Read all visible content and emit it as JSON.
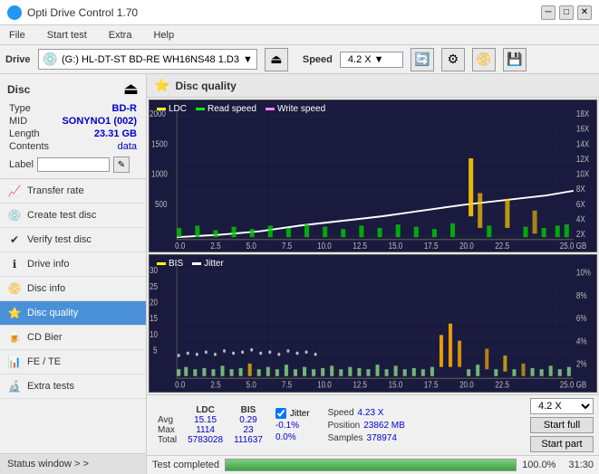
{
  "titlebar": {
    "title": "Opti Drive Control 1.70",
    "icon": "disc-icon",
    "controls": [
      "minimize",
      "maximize",
      "close"
    ]
  },
  "menubar": {
    "items": [
      "File",
      "Start test",
      "Extra",
      "Help"
    ]
  },
  "drivebar": {
    "label": "Drive",
    "drive_value": "(G:)  HL-DT-ST BD-RE  WH16NS48 1.D3",
    "speed_label": "Speed",
    "speed_value": "4.2 X"
  },
  "disc": {
    "section_label": "Disc",
    "type_label": "Type",
    "type_value": "BD-R",
    "mid_label": "MID",
    "mid_value": "SONYNO1 (002)",
    "length_label": "Length",
    "length_value": "23.31 GB",
    "contents_label": "Contents",
    "contents_value": "data",
    "label_label": "Label",
    "label_value": ""
  },
  "sidebar": {
    "items": [
      {
        "id": "transfer-rate",
        "label": "Transfer rate",
        "icon": "📈",
        "active": false
      },
      {
        "id": "create-test-disc",
        "label": "Create test disc",
        "icon": "💿",
        "active": false
      },
      {
        "id": "verify-test-disc",
        "label": "Verify test disc",
        "icon": "✔",
        "active": false
      },
      {
        "id": "drive-info",
        "label": "Drive info",
        "icon": "ℹ",
        "active": false
      },
      {
        "id": "disc-info",
        "label": "Disc info",
        "icon": "📀",
        "active": false
      },
      {
        "id": "disc-quality",
        "label": "Disc quality",
        "icon": "⭐",
        "active": true
      },
      {
        "id": "cd-bier",
        "label": "CD Bier",
        "icon": "🍺",
        "active": false
      },
      {
        "id": "fe-te",
        "label": "FE / TE",
        "icon": "📊",
        "active": false
      },
      {
        "id": "extra-tests",
        "label": "Extra tests",
        "icon": "🔬",
        "active": false
      }
    ],
    "status_window_label": "Status window > >"
  },
  "disc_quality": {
    "title": "Disc quality",
    "icon": "⭐",
    "chart1": {
      "legend": [
        {
          "id": "ldc",
          "label": "LDC",
          "color": "#ffff00"
        },
        {
          "id": "read-speed",
          "label": "Read speed",
          "color": "#00ff00"
        },
        {
          "id": "write-speed",
          "label": "Write speed",
          "color": "#ff00ff"
        }
      ],
      "y_labels": [
        "18X",
        "16X",
        "14X",
        "12X",
        "10X",
        "8X",
        "6X",
        "4X",
        "2X"
      ],
      "x_labels": [
        "0.0",
        "2.5",
        "5.0",
        "7.5",
        "10.0",
        "12.5",
        "15.0",
        "17.5",
        "20.0",
        "22.5",
        "25.0"
      ],
      "x_unit": "GB"
    },
    "chart2": {
      "legend": [
        {
          "id": "bis",
          "label": "BIS",
          "color": "#ffff00"
        },
        {
          "id": "jitter",
          "label": "Jitter",
          "color": "#ffffff"
        }
      ],
      "y_labels_left": [
        "30",
        "25",
        "20",
        "15",
        "10",
        "5",
        ""
      ],
      "y_labels_right": [
        "10%",
        "8%",
        "6%",
        "4%",
        "2%"
      ],
      "x_labels": [
        "0.0",
        "2.5",
        "5.0",
        "7.5",
        "10.0",
        "12.5",
        "15.0",
        "17.5",
        "20.0",
        "22.5",
        "25.0"
      ],
      "x_unit": "GB"
    },
    "stats": {
      "headers": [
        "",
        "LDC",
        "BIS",
        "",
        "Jitter",
        "Speed",
        ""
      ],
      "avg_label": "Avg",
      "avg_ldc": "15.15",
      "avg_bis": "0.29",
      "avg_jitter": "-0.1%",
      "avg_speed": "",
      "max_label": "Max",
      "max_ldc": "1114",
      "max_bis": "23",
      "max_jitter": "0.0%",
      "total_label": "Total",
      "total_ldc": "5783028",
      "total_bis": "111637",
      "speed_current": "4.23 X",
      "position_label": "Position",
      "position_value": "23862 MB",
      "samples_label": "Samples",
      "samples_value": "378974",
      "speed_dropdown": "4.2 X",
      "jitter_checked": true,
      "jitter_label": "Jitter"
    },
    "buttons": {
      "start_full": "Start full",
      "start_part": "Start part"
    },
    "progress": {
      "percent": 100,
      "label": "Test completed",
      "time": "31:30"
    }
  }
}
